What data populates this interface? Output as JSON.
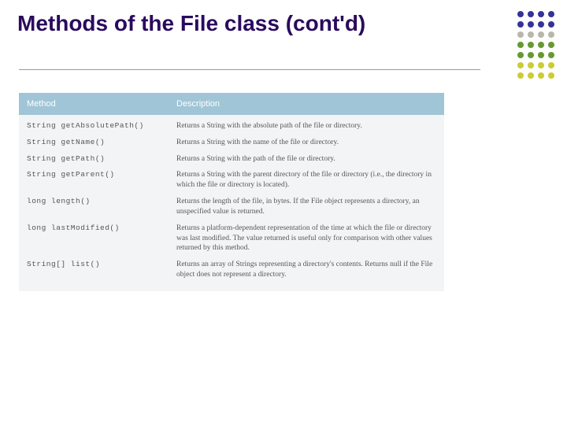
{
  "slide": {
    "title": "Methods of the File class (cont'd)"
  },
  "dotColors": [
    [
      "#333399",
      "#333399",
      "#333399",
      "#333399"
    ],
    [
      "#333399",
      "#333399",
      "#333399",
      "#333399"
    ],
    [
      "#b8b8a8",
      "#b8b8a8",
      "#b8b8a8",
      "#b8b8a8"
    ],
    [
      "#669933",
      "#669933",
      "#669933",
      "#669933"
    ],
    [
      "#669933",
      "#669933",
      "#669933",
      "#669933"
    ],
    [
      "#cccc33",
      "#cccc33",
      "#cccc33",
      "#cccc33"
    ],
    [
      "#cccc33",
      "#cccc33",
      "#cccc33",
      "#cccc33"
    ]
  ],
  "table": {
    "headers": {
      "method": "Method",
      "description": "Description"
    },
    "rows": [
      {
        "method": "String getAbsolutePath()",
        "description": "Returns a String with the absolute path of the file or directory."
      },
      {
        "method": "String getName()",
        "description": "Returns a String with the name of the file or directory."
      },
      {
        "method": "String getPath()",
        "description": "Returns a String with the path of the file or directory."
      },
      {
        "method": "String getParent()",
        "description": "Returns a String with the parent directory of the file or directory (i.e., the directory in which the file or directory is located)."
      },
      {
        "method": "long length()",
        "description": "Returns the length of the file, in bytes. If the File object represents a directory, an unspecified value is returned."
      },
      {
        "method": "long lastModified()",
        "description": "Returns a platform-dependent representation of the time at which the file or directory was last modified. The value returned is useful only for comparison with other values returned by this method."
      },
      {
        "method": "String[] list()",
        "description": "Returns an array of Strings representing a directory's contents. Returns null if the File object does not represent a directory."
      }
    ]
  }
}
